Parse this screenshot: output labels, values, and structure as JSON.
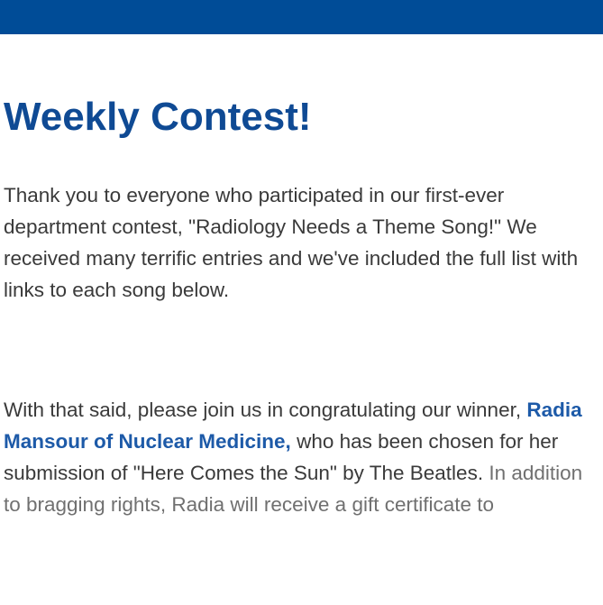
{
  "header": {
    "bar_color": "#004c97"
  },
  "article": {
    "title": "Weekly Contest!",
    "paragraph1": "Thank you to everyone who participated in our first-ever department contest, \"Radiology Needs a Theme Song!\" We received many terrific entries and we've included the full list with links to each song below.",
    "paragraph2": {
      "lead": "With that said, please join us in congratulating our winner, ",
      "winner_link": "Radia Mansour of Nuclear Medicine,",
      "after_link": " who has been chosen for her submission of \"Here Comes the Sun\" by The Beatles.",
      "continued": " In addition to bragging rights, Radia will receive a gift certificate to"
    }
  },
  "colors": {
    "title": "#0f4a94",
    "link": "#1d5aa8",
    "body_text": "#3a3a3a",
    "muted_text": "#707070"
  }
}
